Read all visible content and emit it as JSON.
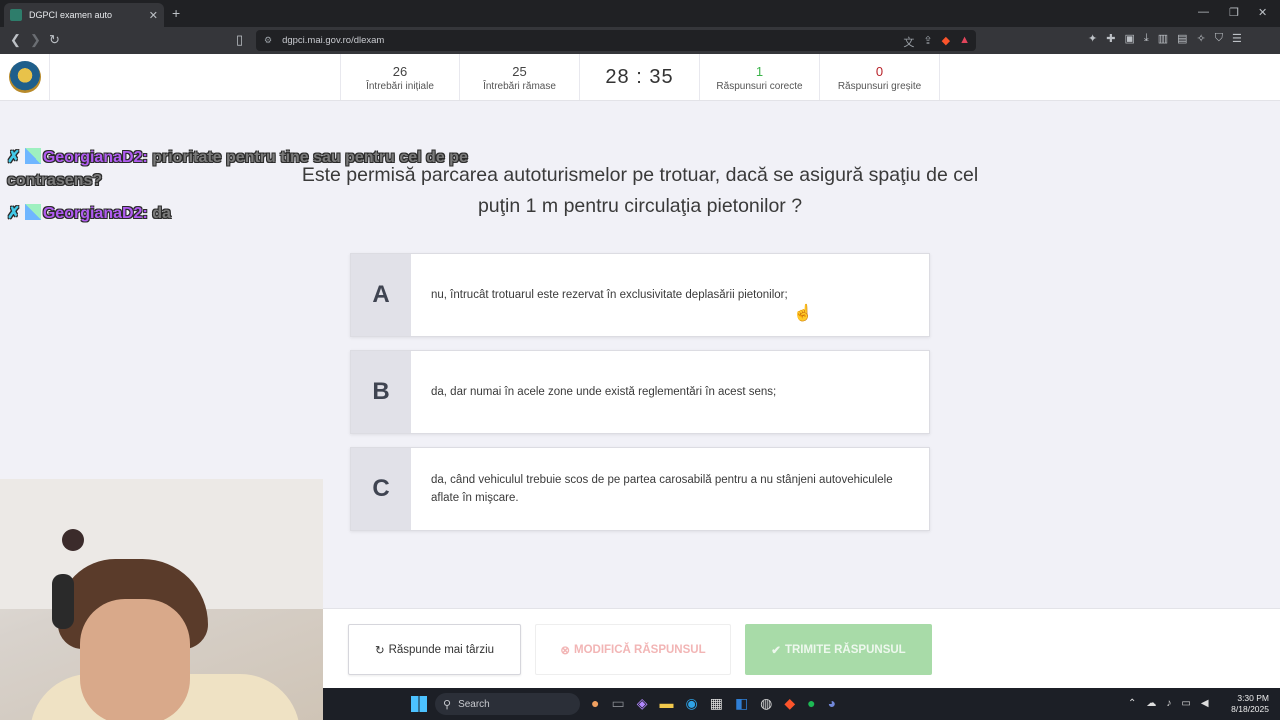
{
  "browser": {
    "tab_title": "DGPCI examen auto",
    "tab_close": "✕",
    "new_tab": "+",
    "url": "dgpci.mai.gov.ro/dlexam",
    "window_controls": [
      "—",
      "❐",
      "✕"
    ]
  },
  "stats": {
    "initial": {
      "value": "26",
      "label": "Întrebări inițiale"
    },
    "remaining": {
      "value": "25",
      "label": "Întrebări rămase"
    },
    "timer": "28 : 35",
    "correct": {
      "value": "1",
      "label": "Răspunsuri corecte",
      "color": "#3cb44b"
    },
    "wrong": {
      "value": "0",
      "label": "Răspunsuri greșite",
      "color": "#b8242b"
    }
  },
  "chat": [
    {
      "user": "GeorgianaD2:",
      "message": "prioritate pentru tine sau pentru cel de pe contrasens?"
    },
    {
      "user": "GeorgianaD2:",
      "message": "da"
    }
  ],
  "question": "Este permisă parcarea autoturismelor pe trotuar, dacă se asigură spaţiu de cel puţin 1 m pentru circulaţia pietonilor ?",
  "answers": [
    {
      "letter": "A",
      "text": "nu, întrucât trotuarul este rezervat în exclusivitate deplasării pietonilor;"
    },
    {
      "letter": "B",
      "text": "da, dar numai în acele zone unde există reglementări în acest sens;"
    },
    {
      "letter": "C",
      "text": "da, când vehiculul trebuie scos de pe partea carosabilă pentru a nu stânjeni autovehiculele aflate în mişcare."
    }
  ],
  "actions": {
    "later": "Răspunde mai târziu",
    "modify": "MODIFICĂ RĂSPUNSUL",
    "submit": "TRIMITE RĂSPUNSUL"
  },
  "taskbar": {
    "search": "Search",
    "time": "3:30 PM",
    "date": "8/18/2025"
  },
  "colors": {
    "submit_bg": "#a8dba8",
    "modify_text": "#f2b5b5"
  }
}
